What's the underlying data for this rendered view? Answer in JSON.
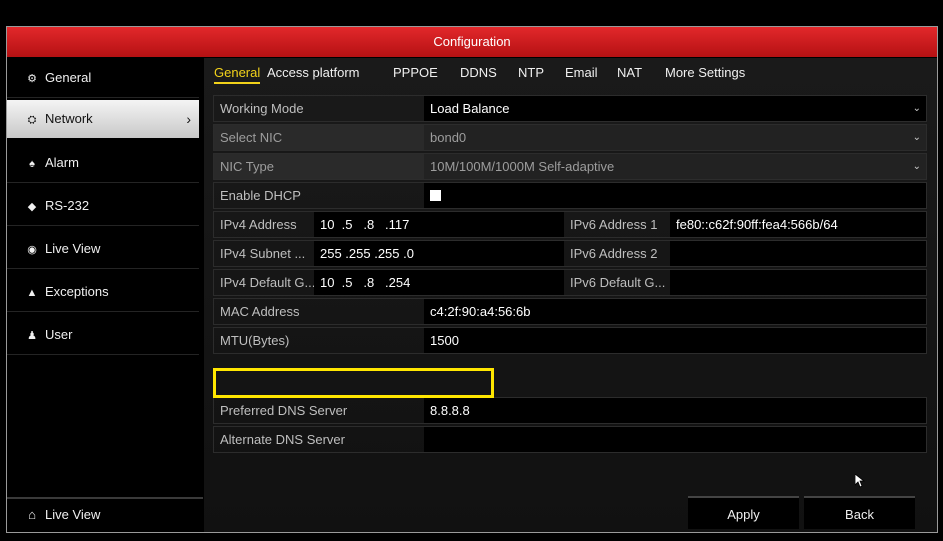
{
  "window": {
    "title": "Configuration"
  },
  "sidebar": {
    "items": [
      {
        "label": "General",
        "icon": "gear-icon",
        "glyph": "⚙"
      },
      {
        "label": "Network",
        "icon": "network-icon",
        "glyph": "⛭",
        "active": true,
        "chevron": "›"
      },
      {
        "label": "Alarm",
        "icon": "alarm-icon",
        "glyph": "♠"
      },
      {
        "label": "RS-232",
        "icon": "serial-port-icon",
        "glyph": "◆"
      },
      {
        "label": "Live View",
        "icon": "eye-icon",
        "glyph": "◉"
      },
      {
        "label": "Exceptions",
        "icon": "warning-icon",
        "glyph": "▲"
      },
      {
        "label": "User",
        "icon": "users-icon",
        "glyph": "♟"
      }
    ],
    "footer": {
      "label": "Live View",
      "icon": "home-icon",
      "glyph": "⌂"
    }
  },
  "tabs": [
    "General",
    "Access platform",
    "PPPOE",
    "DDNS",
    "NTP",
    "Email",
    "NAT",
    "More Settings"
  ],
  "form": {
    "working_mode": {
      "label": "Working Mode",
      "value": "Load Balance"
    },
    "select_nic": {
      "label": "Select NIC",
      "value": "bond0"
    },
    "nic_type": {
      "label": "NIC Type",
      "value": "10M/100M/1000M Self-adaptive"
    },
    "enable_dhcp": {
      "label": "Enable DHCP",
      "checked": false
    },
    "ipv4_address": {
      "label": "IPv4 Address",
      "value": "10  .5   .8   .117"
    },
    "ipv4_subnet": {
      "label": "IPv4 Subnet ...",
      "value": "255 .255 .255 .0"
    },
    "ipv4_gateway": {
      "label": "IPv4 Default G...",
      "value": "10  .5   .8   .254"
    },
    "ipv6_address_1": {
      "label": "IPv6 Address 1",
      "value": "fe80::c62f:90ff:fea4:566b/64"
    },
    "ipv6_address_2": {
      "label": "IPv6 Address 2",
      "value": ""
    },
    "ipv6_gateway": {
      "label": "IPv6 Default G...",
      "value": ""
    },
    "mac_address": {
      "label": "MAC Address",
      "value": "c4:2f:90:a4:56:6b"
    },
    "mtu": {
      "label": "MTU(Bytes)",
      "value": "1500"
    },
    "preferred_dns": {
      "label": "Preferred DNS Server",
      "value": "8.8.8.8"
    },
    "alternate_dns": {
      "label": "Alternate DNS Server",
      "value": ""
    }
  },
  "footer": {
    "apply_label": "Apply",
    "back_label": "Back"
  },
  "colors": {
    "accent": "#d71c1f",
    "tab_active": "#f2d21a",
    "highlight": "#ffe600"
  },
  "dropdown_arrow": "⌄"
}
